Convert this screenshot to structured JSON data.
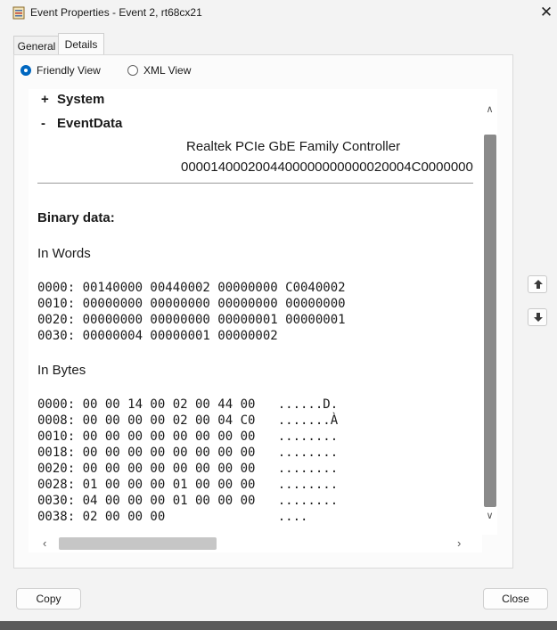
{
  "window": {
    "title": "Event Properties - Event 2, rt68cx21",
    "close_glyph": "✕"
  },
  "tabs": [
    {
      "label": "General"
    },
    {
      "label": "Details"
    }
  ],
  "view_options": {
    "friendly": "Friendly View",
    "xml": "XML View",
    "selected": "Friendly View"
  },
  "details": {
    "system_node": {
      "sign": "+",
      "label": "System"
    },
    "eventdata_node": {
      "sign": "-",
      "label": "EventData"
    },
    "eventdata_values": [
      "Realtek PCIe GbE Family Controller",
      "0000140002004400000000000020004C0000000"
    ],
    "binary_title": "Binary data:",
    "in_words_title": "In Words",
    "words": [
      "0000: 00140000 00440002 00000000 C0040002",
      "0010: 00000000 00000000 00000000 00000000",
      "0020: 00000000 00000000 00000001 00000001",
      "0030: 00000004 00000001 00000002"
    ],
    "in_bytes_title": "In Bytes",
    "bytes": [
      "0000: 00 00 14 00 02 00 44 00   ......D.",
      "0008: 00 00 00 00 02 00 04 C0   .......À",
      "0010: 00 00 00 00 00 00 00 00   ........",
      "0018: 00 00 00 00 00 00 00 00   ........",
      "0020: 00 00 00 00 00 00 00 00   ........",
      "0028: 01 00 00 00 01 00 00 00   ........",
      "0030: 04 00 00 00 01 00 00 00   ........",
      "0038: 02 00 00 00               ...."
    ]
  },
  "buttons": {
    "copy": "Copy",
    "close": "Close"
  },
  "colors": {
    "accent": "#0067c0",
    "window_bg": "#f3f3f3",
    "content_bg": "#ffffff"
  },
  "icons": {
    "app": "event-viewer-icon",
    "prev": "arrow-up-icon",
    "next": "arrow-down-icon"
  }
}
